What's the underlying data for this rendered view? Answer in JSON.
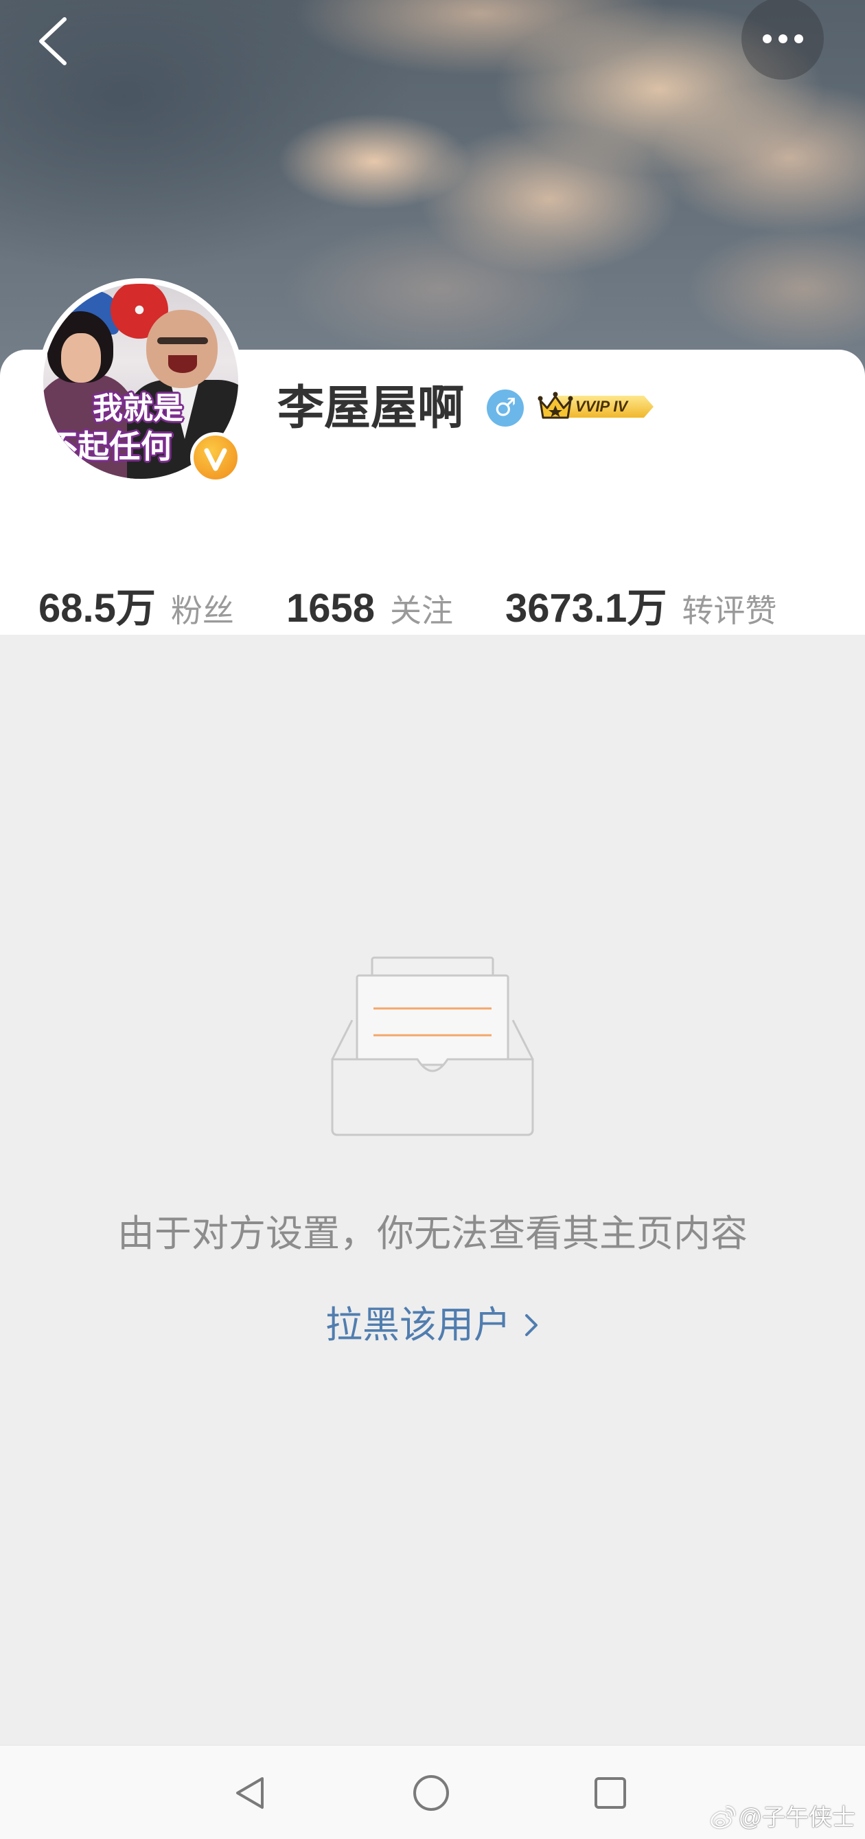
{
  "header": {
    "back_icon": "chevron-left-icon",
    "more_icon": "more-dots-icon"
  },
  "profile": {
    "avatar": {
      "caption_lines": [
        "我就是",
        "不起任何"
      ]
    },
    "verified_icon": "verified-v-icon",
    "name": "李屋屋啊",
    "gender_icon": "male-icon",
    "gender_symbol": "♂",
    "vip_badge": {
      "icon": "crown-icon",
      "label": "VVIP IV"
    }
  },
  "stats": [
    {
      "value": "68.5万",
      "label": "粉丝"
    },
    {
      "value": "1658",
      "label": "关注"
    },
    {
      "value": "3673.1万",
      "label": "转评赞"
    }
  ],
  "empty_state": {
    "icon": "empty-inbox-icon",
    "message": "由于对方设置，你无法查看其主页内容",
    "action_label": "拉黑该用户",
    "action_icon": "chevron-right-icon"
  },
  "nav_bar": {
    "items": [
      {
        "icon": "back-triangle-icon"
      },
      {
        "icon": "home-circle-icon"
      },
      {
        "icon": "recents-square-icon"
      }
    ]
  },
  "watermark": {
    "icon": "weibo-logo-icon",
    "text": "@子午侠士"
  },
  "colors": {
    "link": "#507daf",
    "male": "#6bb7ea",
    "verified": "#f5a623",
    "vip_gold": "#f3c23a",
    "page_bg": "#eeeeee"
  }
}
